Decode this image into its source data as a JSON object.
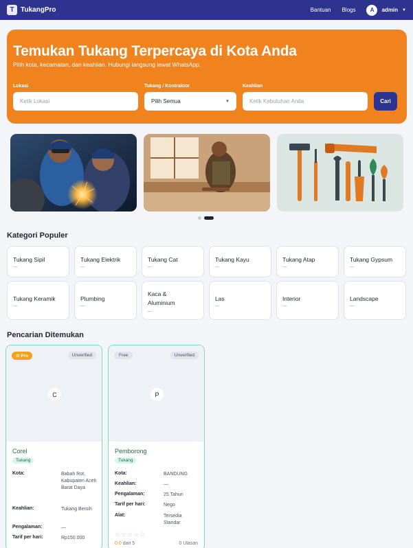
{
  "nav": {
    "logo_letter": "T",
    "brand": "TukangPro",
    "links": [
      "Bantuan",
      "Blogs"
    ],
    "avatar_letter": "A",
    "username": "admin"
  },
  "hero": {
    "title": "Temukan Tukang Terpercaya di Kota Anda",
    "subtitle": "Pilih kota, kecamatan, dan keahlian. Hubungi langsung lewat WhatsApp.",
    "lokasi_label": "Lokasi",
    "lokasi_placeholder": "Ketik Lokasi",
    "tukang_label": "Tukang / Kontraktor",
    "tukang_value": "Pilih Semua",
    "keahlian_label": "Keahlian",
    "keahlian_placeholder": "Ketik Kebutuhan Anda",
    "search_button": "Cari"
  },
  "carousel": {
    "slides": [
      "welders",
      "carpenter",
      "tools"
    ],
    "active_index": 1
  },
  "kategori": {
    "title": "Kategori Populer",
    "items": [
      "Tukang Sipil",
      "Tukang Elektrik",
      "Tukang Cat",
      "Tukang Kayu",
      "Tukang Atap",
      "Tukang Gypsum",
      "Tukang Keramik",
      "Plumbing",
      "Kaca & Aluminium",
      "Las",
      "Interior",
      "Landscape"
    ]
  },
  "results": {
    "title": "Pencarian Ditemukan",
    "cards": [
      {
        "tier": "Pro",
        "status": "Unverified",
        "initial": "C",
        "name": "Corel",
        "tag": "Tukang",
        "labels": {
          "kota": "Kota:",
          "keahlian": "Keahlian:",
          "pengalaman": "Pengalaman:",
          "tarif": "Tarif per hari:"
        },
        "kota": "Babah Rot, Kabupaten Aceh Barat Daya",
        "keahlian": "Tukang Bersih",
        "pengalaman": "—",
        "tarif": "Rp150.000"
      },
      {
        "tier": "Free",
        "status": "Unverified",
        "initial": "P",
        "name": "Pemborong",
        "tag": "Tukang",
        "labels": {
          "kota": "Kota:",
          "keahlian": "Keahlian:",
          "pengalaman": "Pengalaman:",
          "tarif": "Tarif per hari:",
          "alat": "Alat:"
        },
        "kota": "BANDUNG",
        "keahlian": "—",
        "pengalaman": "25 Tahun",
        "tarif": "Nego",
        "alat": "Tersedia Standar",
        "stars": "☆☆☆☆☆",
        "rating": "0.0",
        "rating_suffix": "dari 5",
        "reviews": "0 Ulasan"
      }
    ]
  },
  "colors": {
    "nav": "#2f3390",
    "hero": "#f0831e",
    "accent_green": "#7ed9b8"
  }
}
